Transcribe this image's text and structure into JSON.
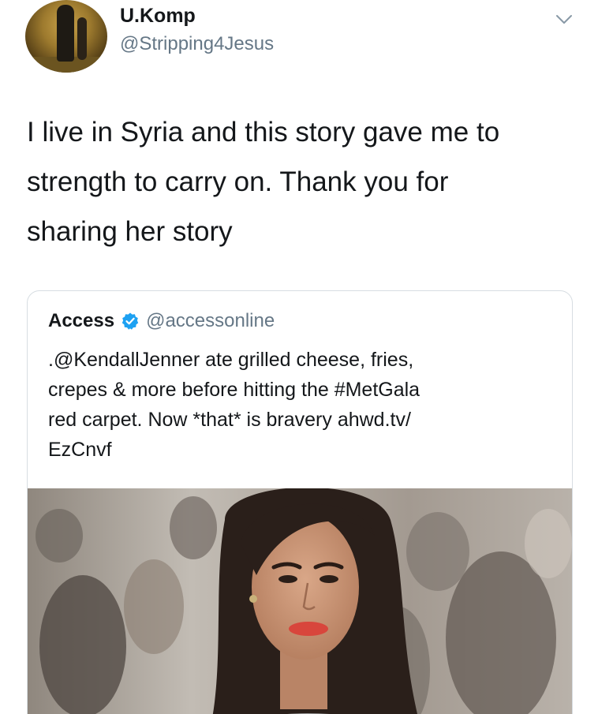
{
  "tweet": {
    "display_name": "U.Komp",
    "handle": "@Stripping4Jesus",
    "avatar_icon": "user-avatar-icon",
    "menu_icon": "chevron-down-icon",
    "text_lines": [
      "I live in Syria and this story gave me to",
      "strength to carry on. Thank you for",
      "sharing her story"
    ]
  },
  "quoted_tweet": {
    "display_name": "Access",
    "verified_icon": "verified-badge-icon",
    "verified_color": "#1da1f2",
    "handle": "@accessonline",
    "text_lines": [
      ".@KendallJenner ate grilled cheese, fries,",
      "crepes & more before hitting the #MetGala",
      "red carpet. Now *that* is bravery ahwd.tv/",
      "EzCnvf"
    ],
    "image_icon": "kendall-jenner-photo"
  },
  "colors": {
    "text_primary": "#14171a",
    "text_secondary": "#657786",
    "border": "#d7dde2",
    "lips": "#d8463c"
  }
}
